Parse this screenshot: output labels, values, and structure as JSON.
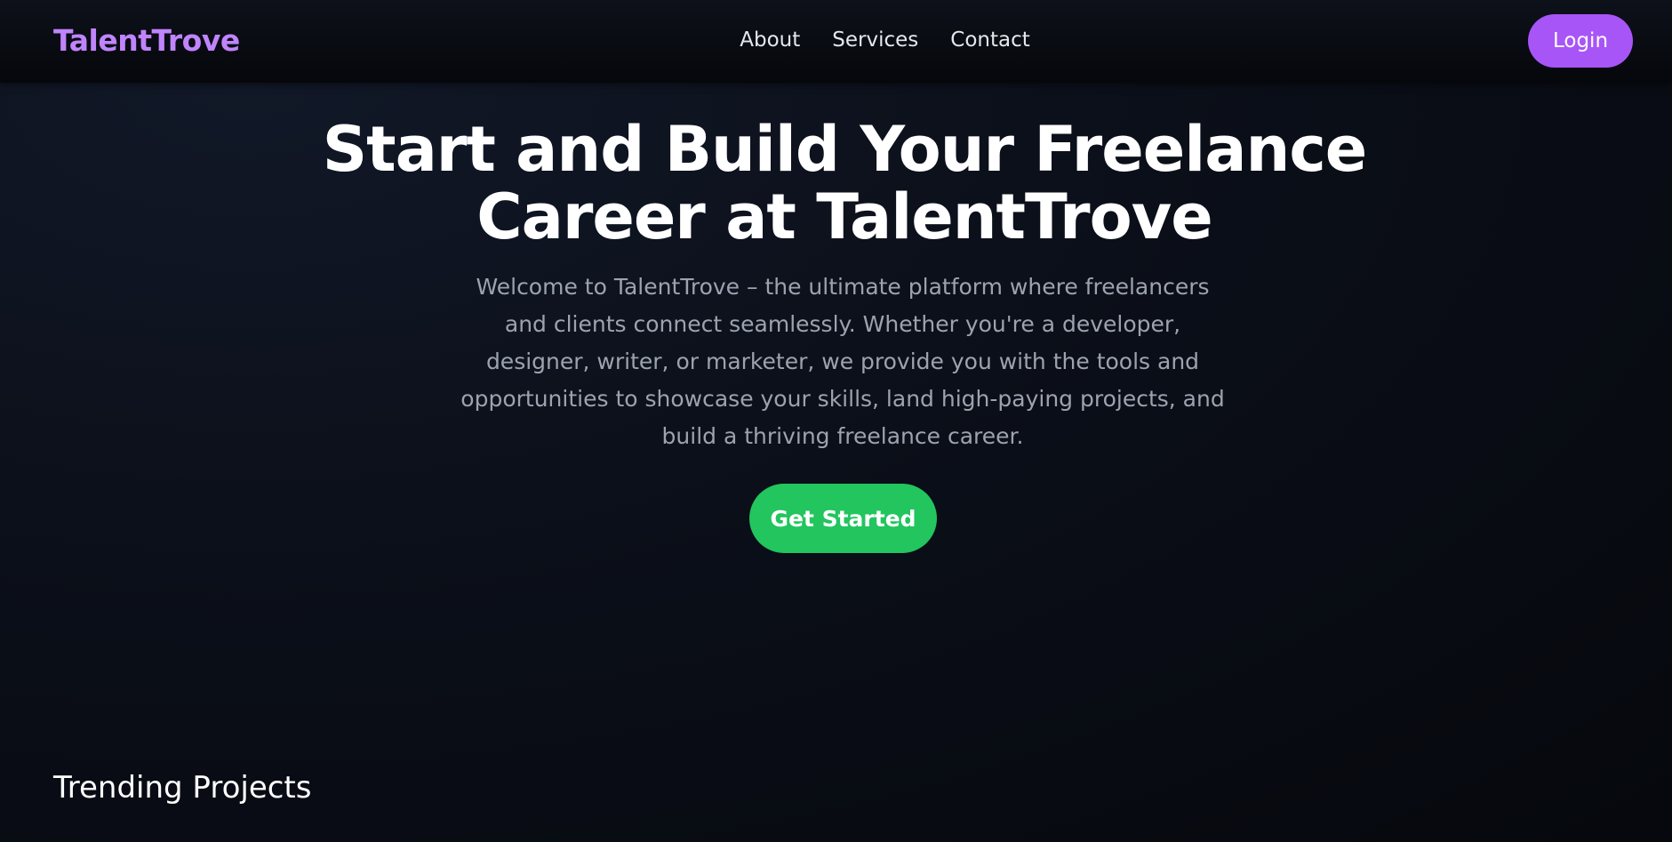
{
  "header": {
    "brand": "TalentTrove",
    "nav": [
      {
        "label": "About"
      },
      {
        "label": "Services"
      },
      {
        "label": "Contact"
      }
    ],
    "login_label": "Login"
  },
  "hero": {
    "title": "Start and Build Your Freelance Career at TalentTrove",
    "description": "Welcome to TalentTrove – the ultimate platform where freelancers and clients connect seamlessly. Whether you're a developer, designer, writer, or marketer, we provide you with the tools and opportunities to showcase your skills, land high-paying projects, and build a thriving freelance career.",
    "cta_label": "Get Started"
  },
  "trending": {
    "title": "Trending Projects"
  },
  "colors": {
    "brand": "#c084fc",
    "login_button": "#a855f7",
    "cta_button": "#22c55e",
    "background": "#0b0f19"
  }
}
